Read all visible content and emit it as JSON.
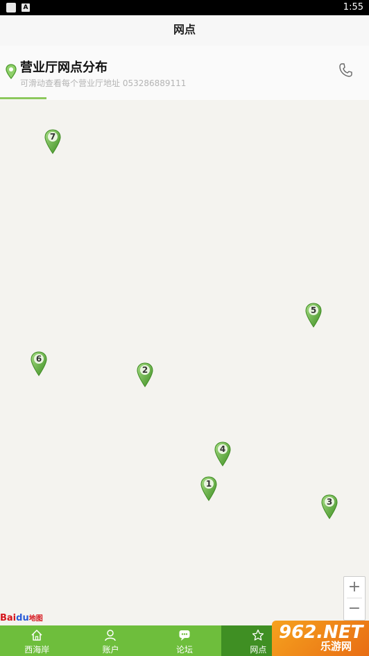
{
  "status_bar": {
    "time": "1:55",
    "notif_icon_label": "A"
  },
  "header": {
    "title": "网点"
  },
  "info": {
    "title": "营业厅网点分布",
    "subtitle": "可滑动查看每个营业厅地址  053286889111",
    "progress": 0.125
  },
  "map": {
    "markers": [
      {
        "number": "7"
      },
      {
        "number": "5"
      },
      {
        "number": "6"
      },
      {
        "number": "2"
      },
      {
        "number": "4"
      },
      {
        "number": "1"
      },
      {
        "number": "3"
      }
    ],
    "zoom_in": "+",
    "zoom_out": "−",
    "attribution": {
      "brand": "Bai",
      "brand2": "du",
      "suffix": "地图"
    }
  },
  "tabs": [
    {
      "label": "西海岸",
      "icon": "home-icon",
      "active": false
    },
    {
      "label": "账户",
      "icon": "user-icon",
      "active": false
    },
    {
      "label": "论坛",
      "icon": "chat-icon",
      "active": false
    },
    {
      "label": "网点",
      "icon": "star-icon",
      "active": true
    },
    {
      "label": "",
      "icon": "",
      "active": false
    }
  ],
  "watermark": {
    "big": "962.NET",
    "small": "乐游网"
  },
  "colors": {
    "accent": "#6ebe3c",
    "accent_dark": "#3f8f23",
    "marker": "#5fb040"
  }
}
